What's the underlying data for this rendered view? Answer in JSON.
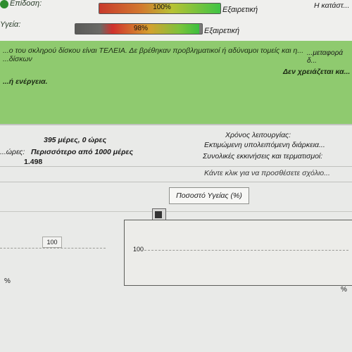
{
  "status": {
    "row1": {
      "label": "Επίδοση:",
      "percent": "100%",
      "value_fraction": 1.0,
      "state": "Εξαιρετική"
    },
    "row2": {
      "label": "Υγεία:",
      "percent": "98%",
      "value_fraction": 0.98,
      "state": "Εξαιρετική"
    }
  },
  "info_panel": {
    "line1": "...ο του σκληρού δίσκου είναι ΤΕΛΕΙΑ. Δε βρέθηκαν προβληματικοί ή αδύναμοι τομείς και η...",
    "line2": "...δίσκων",
    "line3": "Δεν χρειάζεται κα...",
    "line4": "...ή ενέργεια.",
    "corner1": "Η κατάστ...",
    "corner2": "...μεταφορά δ..."
  },
  "details": {
    "power_on": "395 μέρες, 0 ώρες",
    "power_on_prefix": "...ώρες:",
    "estimated_life": "Περισσότερο από 1000 μέρες",
    "start_count": "1.498",
    "label_uptime": "Χρόνος λειτουργίας:",
    "label_life": "Εκτιμώμενη υπολειπόμενη διάρκεια...",
    "label_starts": "Συνολικές εκκινήσεις και τερματισμοί:"
  },
  "hint": "Κάντε κλικ για να προσθέσετε σχόλιο...",
  "chart_controls": {
    "button_label": "Ποσοστό Υγείας (%)",
    "field_value": "100",
    "plot_tick": "100",
    "axis_left": "%",
    "axis_right": "%"
  }
}
